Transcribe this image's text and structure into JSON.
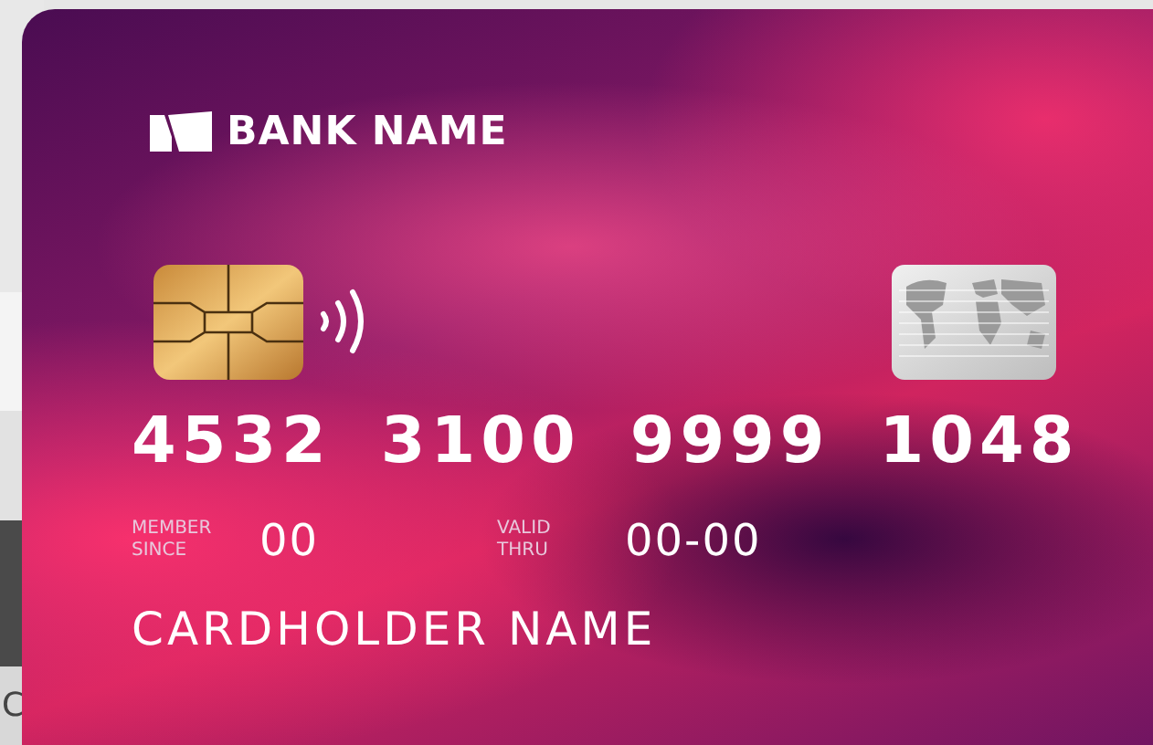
{
  "page": {
    "side_text": "C"
  },
  "card": {
    "bank_name": "BANK NAME",
    "number_groups": [
      "4532",
      "3100",
      "9999",
      "1048"
    ],
    "member_since": {
      "label": "MEMBER SINCE",
      "value": "00"
    },
    "valid_thru": {
      "label": "VALID THRU",
      "value": "00-00"
    },
    "cardholder_name": "CARDHOLDER NAME"
  }
}
